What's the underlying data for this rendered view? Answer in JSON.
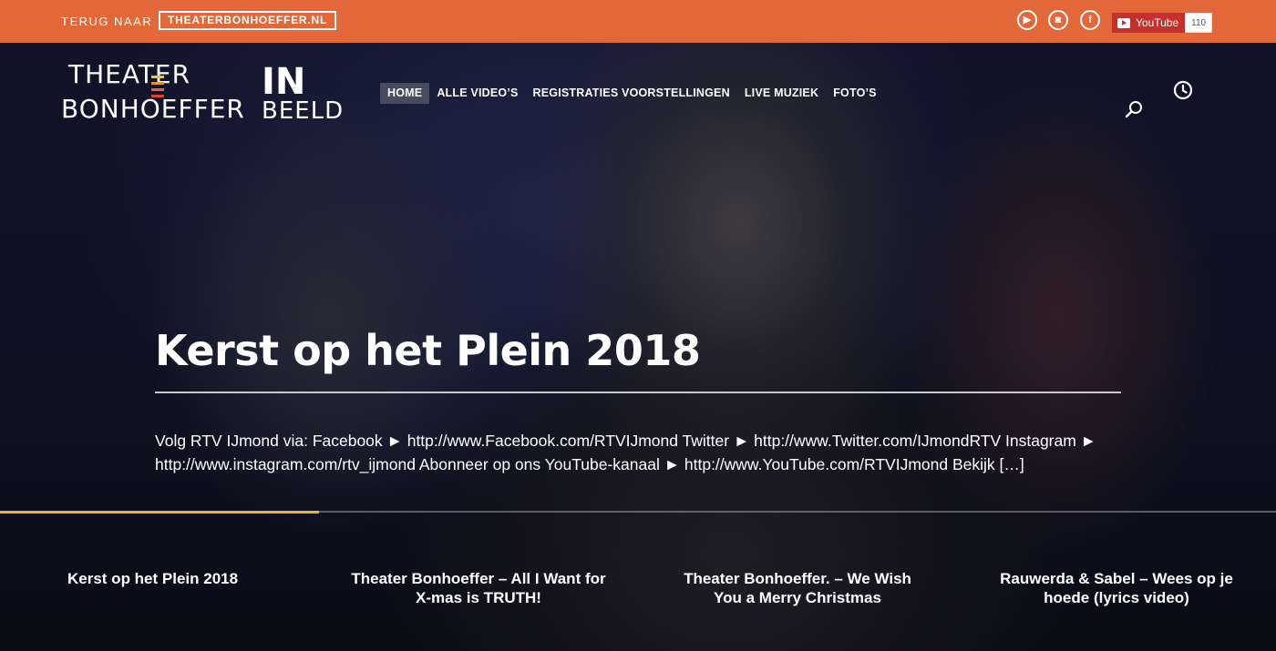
{
  "topbar": {
    "back_label": "TERUG NAAR",
    "back_link": "THEATERBONHOEFFER.NL",
    "social": [
      {
        "icon": "youtube-icon",
        "glyph": "▶"
      },
      {
        "icon": "instagram-icon",
        "glyph": "◙"
      },
      {
        "icon": "facebook-icon",
        "glyph": "f"
      }
    ],
    "youtube_button": {
      "label": "YouTube",
      "count": "110"
    }
  },
  "logo": {
    "line1": "THEATER",
    "line2": "BONHOEFFER",
    "line3": "IN",
    "line4": "BEELD",
    "bar_colors": [
      "#f2c230",
      "#ec8f2f",
      "#e2683a",
      "#d9433a"
    ]
  },
  "nav": {
    "items": [
      {
        "label": "HOME",
        "active": true
      },
      {
        "label": "ALLE VIDEO’S",
        "active": false
      },
      {
        "label": "REGISTRATIES VOORSTELLINGEN",
        "active": false
      },
      {
        "label": "LIVE MUZIEK",
        "active": false
      },
      {
        "label": "FOTO’S",
        "active": false
      }
    ]
  },
  "hero": {
    "title": "Kerst op het Plein 2018",
    "description": "Volg RTV IJmond via: Facebook ► http://www.Facebook.com/RTVIJmond Twitter ► http://www.Twitter.com/IJmondRTV Instagram ► http://www.instagram.com/rtv_ijmond Abonneer op ons YouTube-kanaal ► http://www.YouTube.com/RTVIJmond Bekijk […]",
    "progress_fraction": 0.25
  },
  "slides": [
    {
      "title": "Kerst op het Plein 2018"
    },
    {
      "title": "Theater Bonhoeffer – All I Want for X-mas is TRUTH!"
    },
    {
      "title": "Theater Bonhoeffer. – We Wish You a Merry Christmas"
    },
    {
      "title": "Rauwerda & Sabel – Wees op je hoede (lyrics video)"
    }
  ],
  "colors": {
    "topbar": "#e2683a",
    "accent_progress": "#e8b526",
    "youtube_red": "#c4302b"
  }
}
